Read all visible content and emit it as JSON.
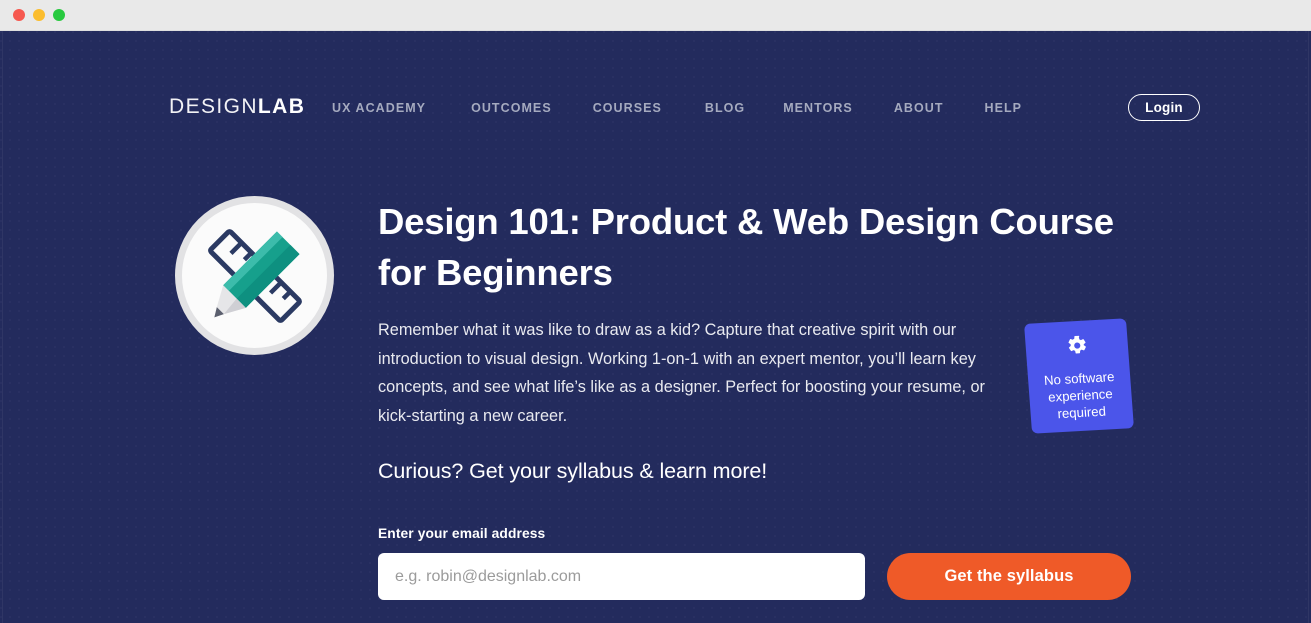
{
  "window": {
    "traffic_lights": [
      {
        "name": "close",
        "color": "#f6584f"
      },
      {
        "name": "minimize",
        "color": "#fbbd2e"
      },
      {
        "name": "maximize",
        "color": "#28c93f"
      }
    ]
  },
  "theme": {
    "background_navy": "#232b5d",
    "accent_orange": "#ef5a28",
    "badge_blue": "#4b55ea",
    "pencil_teal": "#17a08e",
    "nav_link_grey": "#a5aabf"
  },
  "nav": {
    "logo": {
      "part1": "DESIGN",
      "part2": "LAB"
    },
    "links": [
      {
        "label": "UX ACADEMY"
      },
      {
        "label": "OUTCOMES"
      },
      {
        "label": "COURSES"
      },
      {
        "label": "BLOG"
      },
      {
        "label": "MENTORS"
      },
      {
        "label": "ABOUT"
      },
      {
        "label": "HELP"
      }
    ],
    "login_label": "Login"
  },
  "hero": {
    "illustration_icon": "pencil-and-ruler-icon",
    "headline": "Design 101: Product & Web Design Course for Beginners",
    "paragraph": "Remember what it was like to draw as a kid? Capture that creative spirit with our introduction to visual design. Working 1-on-1 with an expert mentor, you’ll learn key concepts, and see what life’s like as a designer. Perfect for boosting your resume, or kick-starting a new career.",
    "subheadline": "Curious? Get your syllabus & learn more!",
    "badge": {
      "icon": "gear-icon",
      "text": "No software\nexperience\nrequired"
    }
  },
  "form": {
    "label": "Enter your email address",
    "email_value": "",
    "email_placeholder": "e.g. robin@designlab.com",
    "submit_label": "Get the syllabus"
  }
}
